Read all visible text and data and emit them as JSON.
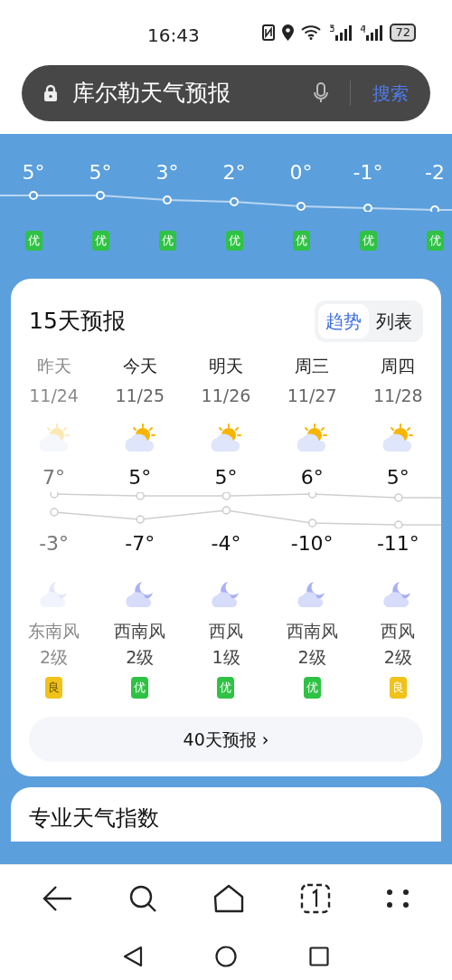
{
  "status_bar": {
    "time": "16:43",
    "battery": "72"
  },
  "search_bar": {
    "value": "库尔勒天气预报",
    "button": "搜索"
  },
  "hourly": [
    {
      "temp": "5°",
      "quality": "优",
      "color": "#2fc244"
    },
    {
      "temp": "5°",
      "quality": "优",
      "color": "#2fc244"
    },
    {
      "temp": "3°",
      "quality": "优",
      "color": "#2fc244"
    },
    {
      "temp": "2°",
      "quality": "优",
      "color": "#2fc244"
    },
    {
      "temp": "0°",
      "quality": "优",
      "color": "#2fc244"
    },
    {
      "temp": "-1°",
      "quality": "优",
      "color": "#2fc244"
    },
    {
      "temp": "-2",
      "quality": "优",
      "color": "#2fc244"
    }
  ],
  "forecast": {
    "title": "15天预报",
    "view_tabs": [
      {
        "label": "趋势",
        "selected": true
      },
      {
        "label": "列表",
        "selected": false
      }
    ],
    "days": [
      {
        "day": "昨天",
        "date": "11/24",
        "high": "7°",
        "low": "-3°",
        "wind": "东南风",
        "wind_level": "2级",
        "quality": "良",
        "color": "#f0c21a",
        "past": true
      },
      {
        "day": "今天",
        "date": "11/25",
        "high": "5°",
        "low": "-7°",
        "wind": "西南风",
        "wind_level": "2级",
        "quality": "优",
        "color": "#2fc244",
        "past": false
      },
      {
        "day": "明天",
        "date": "11/26",
        "high": "5°",
        "low": "-4°",
        "wind": "西风",
        "wind_level": "1级",
        "quality": "优",
        "color": "#2fc244",
        "past": false
      },
      {
        "day": "周三",
        "date": "11/27",
        "high": "6°",
        "low": "-10°",
        "wind": "西南风",
        "wind_level": "2级",
        "quality": "优",
        "color": "#2fc244",
        "past": false
      },
      {
        "day": "周四",
        "date": "11/28",
        "high": "5°",
        "low": "-11°",
        "wind": "西风",
        "wind_level": "2级",
        "quality": "良",
        "color": "#f0c21a",
        "past": false
      }
    ],
    "more_button": "40天预报 ›"
  },
  "next_card": {
    "title": "专业天气指数"
  }
}
